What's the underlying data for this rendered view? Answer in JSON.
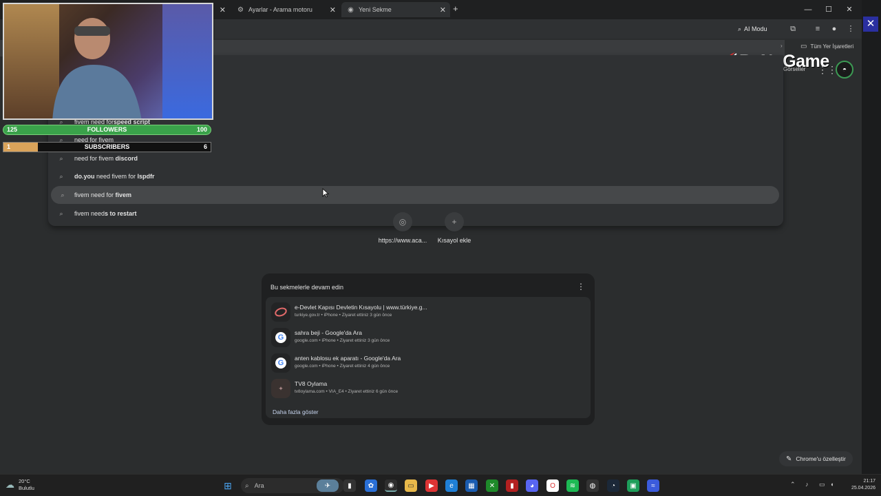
{
  "tabs": [
    {
      "label": "Ayarlar - Arama motoru",
      "icon": "gear-icon"
    },
    {
      "label": "Yeni Sekme",
      "icon": "chrome-icon",
      "active": true
    }
  ],
  "toolbar": {
    "ai_mode": "AI Modu"
  },
  "bookmarks": {
    "all_label": "Tüm Yer İşaretleri"
  },
  "logo": {
    "text": "ByNoGame"
  },
  "header": {
    "images_link": "Görseller"
  },
  "suggestions": [
    {
      "prefix": "fivem need for ",
      "bold": "speed script"
    },
    {
      "prefix": "need for fivem",
      "bold": ""
    },
    {
      "prefix": "need for fivem ",
      "bold": "discord"
    },
    {
      "prefix": "",
      "bold": "do.you",
      "suffix": " need fivem for ",
      "bold2": "lspdfr"
    },
    {
      "prefix": "fivem need for ",
      "bold": "fivem",
      "highlight": true
    },
    {
      "prefix": "fivem need",
      "bold": "s to restart"
    }
  ],
  "shortcuts": [
    {
      "label": "https://www.aca..."
    },
    {
      "label": "Kısayol ekle"
    }
  ],
  "resume": {
    "title": "Bu sekmelerle devam edin",
    "items": [
      {
        "title": "e-Devlet Kapısı Devletin Kısayolu | www.türkiye.g...",
        "sub": "turkiye.gov.tr • iPhone • Ziyaret ettiniz 3 gün önce",
        "icon": "edevlet-icon"
      },
      {
        "title": "sahra beji - Google'da Ara",
        "sub": "google.com • iPhone • Ziyaret ettiniz 3 gün önce",
        "icon": "google-icon"
      },
      {
        "title": "anten kablosu ek aparatı - Google'da Ara",
        "sub": "google.com • iPhone • Ziyaret ettiniz 4 gün önce",
        "icon": "google-icon"
      },
      {
        "title": "TV8 Oylama",
        "sub": "tv8oylama.com • VIA_E4 • Ziyaret ettiniz 6 gün önce",
        "icon": "tv8-icon"
      }
    ],
    "more": "Daha fazla göster"
  },
  "customize": {
    "label": "Chrome'u özelleştir"
  },
  "overlay": {
    "followers": {
      "label": "FOLLOWERS",
      "current": "125",
      "goal": "100",
      "progress": 1.0
    },
    "subscribers": {
      "label": "SUBSCRIBERS",
      "current": "1",
      "goal": "6",
      "progress": 0.167
    }
  },
  "taskbar": {
    "weather_temp": "20°C",
    "weather_desc": "Bulutlu",
    "search_placeholder": "Ara",
    "time": "21:17",
    "date": "25.04.2026"
  }
}
